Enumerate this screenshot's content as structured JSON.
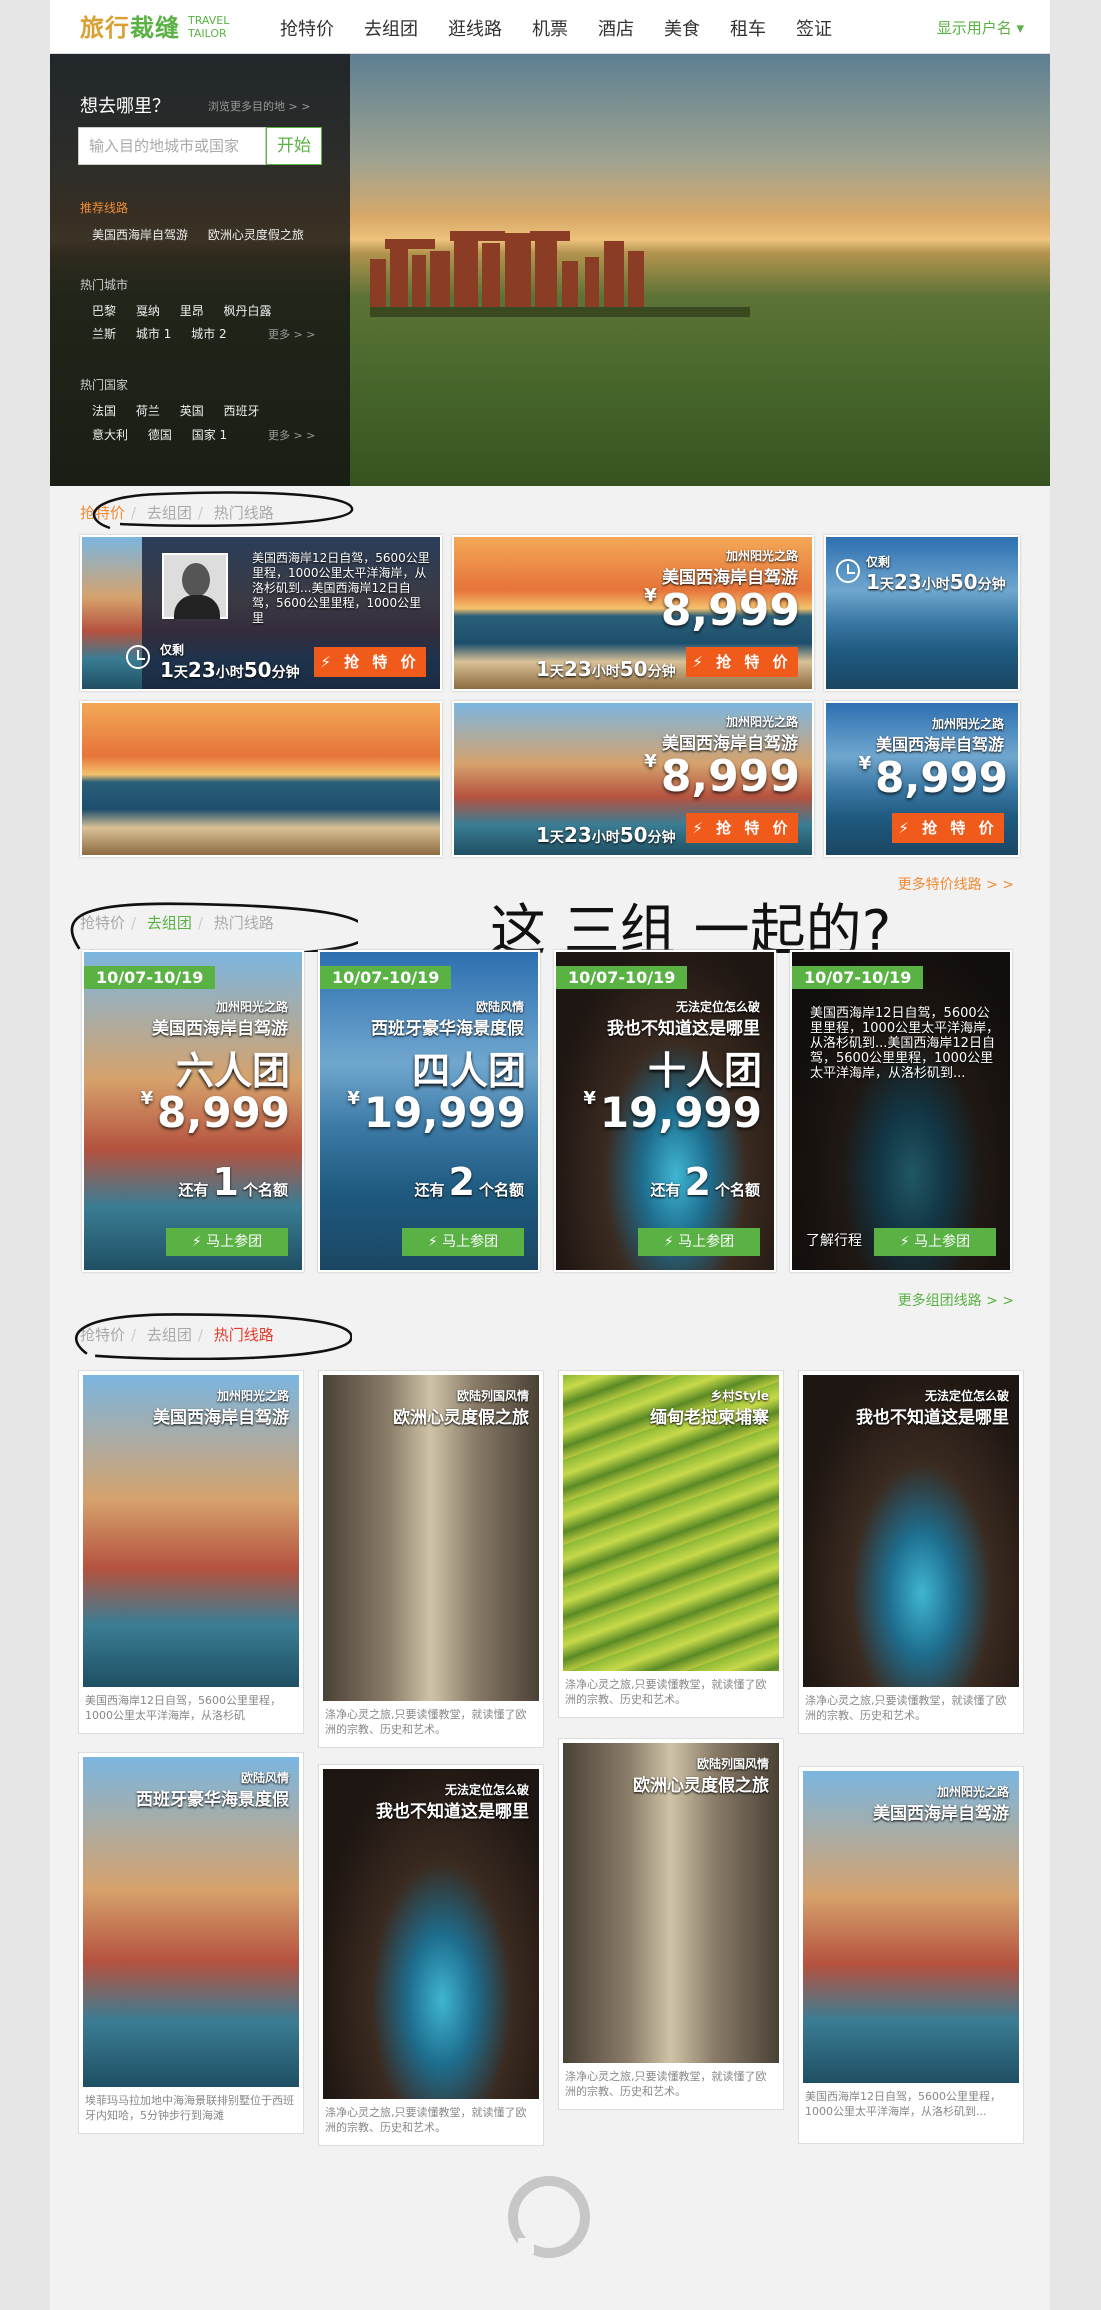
{
  "nav": {
    "logo_cn_a": "旅行",
    "logo_cn_b": "裁缝",
    "logo_en_1": "TRAVEL",
    "logo_en_2": "TAILOR",
    "items": [
      "抢特价",
      "去组团",
      "逛线路",
      "机票",
      "酒店",
      "美食",
      "租车",
      "签证"
    ],
    "user": "显示用户名 ▾"
  },
  "hero": {
    "question": "想去哪里？",
    "browse_more": "浏览更多目的地 > >",
    "search_placeholder": "输入目的地城市或国家",
    "go": "开始",
    "recommended_label": "推荐线路",
    "recommended": [
      "美国西海岸自驾游",
      "欧洲心灵度假之旅"
    ],
    "hot_cities_label": "热门城市",
    "hot_cities_row1": [
      "巴黎",
      "戛纳",
      "里昂",
      "枫丹白露"
    ],
    "hot_cities_row2": [
      "兰斯",
      "城市 1",
      "城市 2"
    ],
    "hot_countries_label": "热门国家",
    "hot_countries_row1": [
      "法国",
      "荷兰",
      "英国",
      "西班牙"
    ],
    "hot_countries_row2": [
      "意大利",
      "德国",
      "国家 1"
    ],
    "more": "更多 > >"
  },
  "tabs": [
    "抢特价",
    "去组团",
    "热门线路"
  ],
  "deals": {
    "tag_small": "加州阳光之路",
    "tag_big": "美国西海岸自驾游",
    "price_sym": "¥",
    "price": "8,999",
    "grab": "抢 特 价",
    "only": "仅剩",
    "time_d": "1",
    "time_d_u": "天",
    "time_h": "23",
    "time_h_u": "小时",
    "time_m": "50",
    "time_m_u": "分钟",
    "desc": "美国西海岸12日自驾，5600公里里程，1000公里太平洋海岸，从洛杉矶到...美国西海岸12日自驾，5600公里里程，1000公里里",
    "more": "更多特价线路 > >"
  },
  "groups": {
    "more": "更多组团线路 > >",
    "date": "10/07-10/19",
    "cards": [
      {
        "small": "加州阳光之路",
        "big": "美国西海岸自驾游",
        "name": "六人团",
        "price": "8,999",
        "left_pre": "还有",
        "left_n": "1",
        "left_post": "个名额",
        "btn": "马上参团"
      },
      {
        "small": "欧陆风情",
        "big": "西班牙豪华海景度假",
        "name": "四人团",
        "price": "19,999",
        "left_pre": "还有",
        "left_n": "2",
        "left_post": "个名额",
        "btn": "马上参团"
      },
      {
        "small": "无法定位怎么破",
        "big": "我也不知道这是哪里",
        "name": "十人团",
        "price": "19,999",
        "left_pre": "还有",
        "left_n": "2",
        "left_post": "个名额",
        "btn": "马上参团"
      },
      {
        "desc": "美国西海岸12日自驾，5600公里里程，1000公里太平洋海岸，从洛杉矶到...美国西海岸12日自驾，5600公里里程，1000公里太平洋海岸，从洛杉矶到...",
        "know": "了解行程",
        "btn": "马上参团"
      }
    ]
  },
  "routes": [
    {
      "small": "加州阳光之路",
      "big": "美国西海岸自驾游",
      "text": "美国西海岸12日自驾，5600公里里程，1000公里太平洋海岸，从洛杉矶"
    },
    {
      "small": "欧陆列国风情",
      "big": "欧洲心灵度假之旅",
      "text": "涤净心灵之旅,只要读懂教堂，就读懂了欧洲的宗教、历史和艺术。"
    },
    {
      "small": "乡村Style",
      "big": "缅甸老挝柬埔寨",
      "text": "涤净心灵之旅,只要读懂教堂，就读懂了欧洲的宗教、历史和艺术。"
    },
    {
      "small": "无法定位怎么破",
      "big": "我也不知道这是哪里",
      "text": "涤净心灵之旅,只要读懂教堂，就读懂了欧洲的宗教、历史和艺术。"
    },
    {
      "small": "欧陆风情",
      "big": "西班牙豪华海景度假",
      "text": "埃菲玛马拉加地中海海景联排别墅位于西班牙内知哈，5分钟步行到海滩"
    },
    {
      "small": "无法定位怎么破",
      "big": "我也不知道这是哪里",
      "text": "涤净心灵之旅,只要读懂教堂，就读懂了欧洲的宗教、历史和艺术。"
    },
    {
      "small": "欧陆列国风情",
      "big": "欧洲心灵度假之旅",
      "text": "涤净心灵之旅,只要读懂教堂，就读懂了欧洲的宗教、历史和艺术。"
    },
    {
      "small": "加州阳光之路",
      "big": "美国西海岸自驾游",
      "text": "美国西海岸12日自驾，5600公里里程，1000公里太平洋海岸，从洛杉矶到..."
    }
  ],
  "handnote": "这 三组 一起的?",
  "colors": {
    "green": "#5ab245",
    "orange": "#f08b36",
    "grab": "#f05a1a",
    "red": "#e53b2c"
  }
}
